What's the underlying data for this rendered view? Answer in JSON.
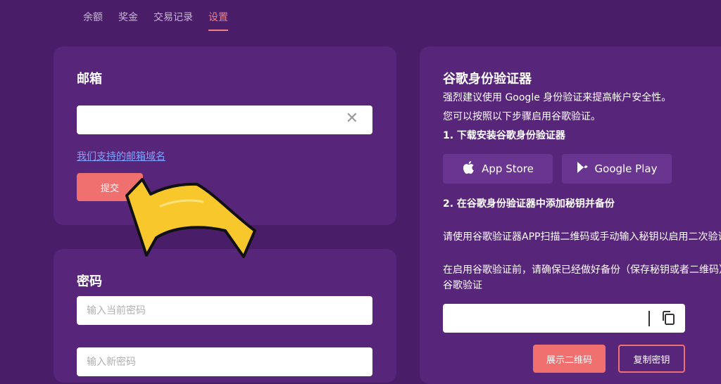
{
  "tabs": [
    "余额",
    "奖金",
    "交易记录",
    "设置"
  ],
  "email": {
    "title": "邮箱",
    "value": "",
    "clear": "✕",
    "domains_link": "我们支持的邮箱域名",
    "submit": "提交"
  },
  "password": {
    "title": "密码",
    "current_placeholder": "输入当前密码",
    "new_placeholder": "输入新密码"
  },
  "ga": {
    "title": "谷歌身份验证器",
    "line1": "强烈建议使用 Google 身份验证来提高帐户安全性。",
    "line2": "您可以按照以下步骤启用谷歌验证。",
    "step1": "1. 下载安装谷歌身份验证器",
    "app_store": "App Store",
    "google_play": "Google Play",
    "step2": "2. 在谷歌身份验证器中添加秘钥并备份",
    "instr1": "请使用谷歌验证器APP扫描二维码或手动输入秘钥以启用二次验证",
    "instr2": "在启用谷歌验证前，请确保已经做好备份（保存秘钥或者二维码）",
    "instr3": "谷歌验证",
    "show_qr": "展示二维码",
    "copy_key": "复制密钥"
  },
  "colors": {
    "background": "#4a1d68",
    "card": "#57267a",
    "accent": "#f07070",
    "arrow": "#f7c72c"
  }
}
